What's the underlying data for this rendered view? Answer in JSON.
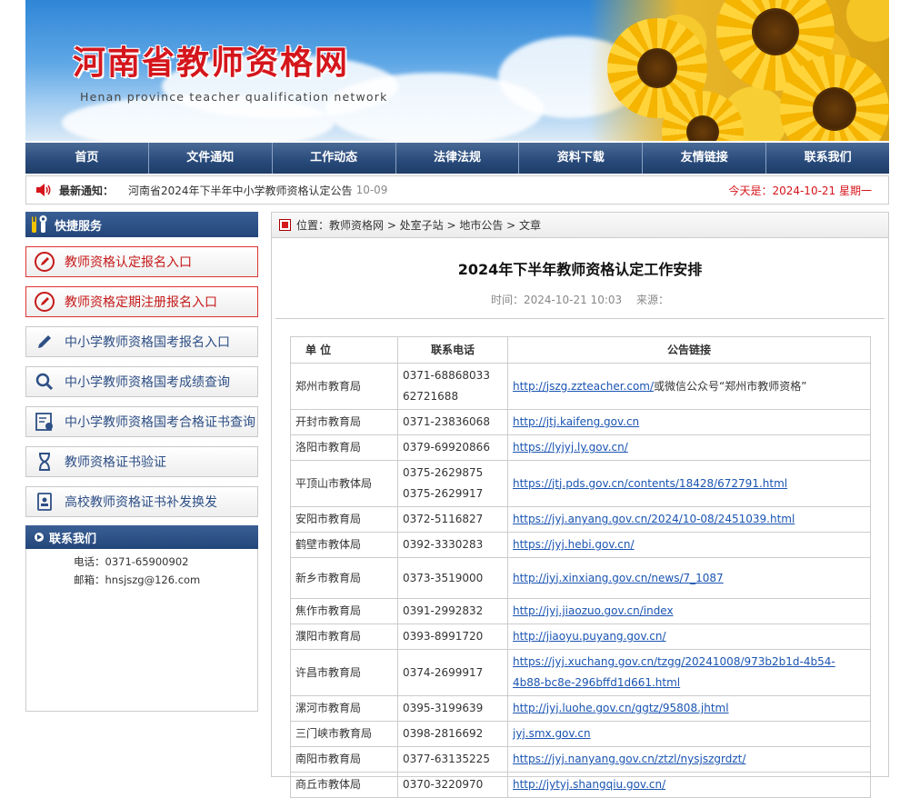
{
  "site": {
    "title": "河南省教师资格网",
    "subtitle": "Henan province teacher qualification network"
  },
  "nav": [
    "首页",
    "文件通知",
    "工作动态",
    "法律法规",
    "资料下载",
    "友情链接",
    "联系我们"
  ],
  "notice": {
    "label": "最新通知：",
    "message": "河南省2024年下半年中小学教师资格认定公告",
    "date": "10-09",
    "today": "今天是：2024-10-21  星期一"
  },
  "sidebar": {
    "quick_title": "快捷服务",
    "services": [
      {
        "label": "教师资格认定报名入口",
        "style": "red",
        "icon": "pencil-circle-icon"
      },
      {
        "label": "教师资格定期注册报名入口",
        "style": "red",
        "icon": "pencil-circle-icon"
      },
      {
        "label": "中小学教师资格国考报名入口",
        "style": "blue",
        "icon": "pencil-icon"
      },
      {
        "label": "中小学教师资格国考成绩查询",
        "style": "blue",
        "icon": "search-icon"
      },
      {
        "label": "中小学教师资格国考合格证书查询",
        "style": "blue",
        "icon": "certificate-icon"
      },
      {
        "label": "教师资格证书验证",
        "style": "blue",
        "icon": "hourglass-icon"
      },
      {
        "label": "高校教师资格证书补发换发",
        "style": "blue",
        "icon": "id-card-icon"
      }
    ],
    "contact_title": "联系我们",
    "phone": "电话：0371-65900902",
    "email": "邮箱：hnsjszg@126.com"
  },
  "breadcrumb": "位置：教师资格网 > 处室子站 > 地市公告 > 文章",
  "article": {
    "title": "2024年下半年教师资格认定工作安排",
    "time": "时间：2024-10-21 10:03",
    "source": "来源："
  },
  "table": {
    "headers": [
      "单 位",
      "联系电话",
      "公告链接"
    ],
    "rows": [
      {
        "unit": "郑州市教育局",
        "phone": [
          "0371-68868033",
          "62721688"
        ],
        "link": "http://jszg.zzteacher.com/",
        "suffix": "或微信公众号“郑州市教师资格”"
      },
      {
        "unit": "开封市教育局",
        "phone": [
          "0371-23836068"
        ],
        "link": "http://jtj.kaifeng.gov.cn",
        "suffix": ""
      },
      {
        "unit": "洛阳市教育局",
        "phone": [
          "0379-69920866"
        ],
        "link": "https://lyjyj.ly.gov.cn/",
        "suffix": ""
      },
      {
        "unit": "平顶山市教体局",
        "phone": [
          "0375-2629875",
          "0375-2629917"
        ],
        "link": "https://jtj.pds.gov.cn/contents/18428/672791.html",
        "suffix": ""
      },
      {
        "unit": "安阳市教育局",
        "phone": [
          "0372-5116827"
        ],
        "link": "https://jyj.anyang.gov.cn/2024/10-08/2451039.html",
        "suffix": ""
      },
      {
        "unit": "鹤壁市教体局",
        "phone": [
          "0392-3330283"
        ],
        "link": "https://jyj.hebi.gov.cn/",
        "suffix": ""
      },
      {
        "unit": "新乡市教育局",
        "phone": [
          "0373-3519000"
        ],
        "link": "http://jyj.xinxiang.gov.cn/news/7_1087",
        "suffix": "",
        "tall": true
      },
      {
        "unit": "焦作市教育局",
        "phone": [
          "0391-2992832"
        ],
        "link": "http://jyj.jiaozuo.gov.cn/index",
        "suffix": ""
      },
      {
        "unit": "濮阳市教育局",
        "phone": [
          "0393-8991720"
        ],
        "link": "http://jiaoyu.puyang.gov.cn/",
        "suffix": ""
      },
      {
        "unit": "许昌市教育局",
        "phone": [
          "0374-2699917"
        ],
        "link": "https://jyj.xuchang.gov.cn/tzgg/20241008/973b2b1d-4b54-4b88-bc8e-296bffd1d661.html",
        "suffix": ""
      },
      {
        "unit": "漯河市教育局",
        "phone": [
          "0395-3199639"
        ],
        "link": "http://jyj.luohe.gov.cn/ggtz/95808.jhtml",
        "suffix": ""
      },
      {
        "unit": "三门峡市教育局",
        "phone": [
          "0398-2816692"
        ],
        "link": "jyj.smx.gov.cn",
        "suffix": ""
      },
      {
        "unit": "南阳市教育局",
        "phone": [
          "0377-63135225"
        ],
        "link": "https://jyj.nanyang.gov.cn/ztzl/nysjszgrdzt/",
        "suffix": ""
      },
      {
        "unit": "商丘市教体局",
        "phone": [
          "0370-3220970"
        ],
        "link": "http://jytyj.shangqiu.gov.cn/",
        "suffix": ""
      }
    ]
  }
}
